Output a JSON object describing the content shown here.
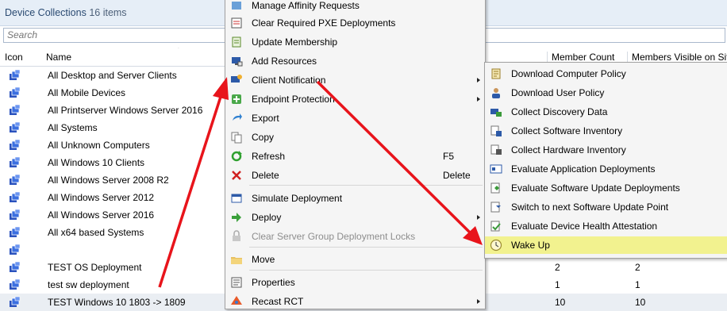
{
  "header": {
    "title": "Device Collections",
    "count": "16 items"
  },
  "search": {
    "placeholder": "Search"
  },
  "columns": {
    "icon": "Icon",
    "name": "Name",
    "member_count": "Member Count",
    "members_visible": "Members Visible on Site"
  },
  "rows": [
    {
      "name": "All Desktop and Server Clients",
      "member_count": "",
      "members_visible": ""
    },
    {
      "name": "All Mobile Devices",
      "member_count": "",
      "members_visible": ""
    },
    {
      "name": "All Printserver Windows Server 2016",
      "member_count": "",
      "members_visible": ""
    },
    {
      "name": "All Systems",
      "member_count": "",
      "members_visible": ""
    },
    {
      "name": "All Unknown Computers",
      "member_count": "",
      "members_visible": ""
    },
    {
      "name": "All Windows 10 Clients",
      "member_count": "",
      "members_visible": ""
    },
    {
      "name": "All Windows Server 2008 R2",
      "member_count": "",
      "members_visible": ""
    },
    {
      "name": "All Windows Server 2012",
      "member_count": "",
      "members_visible": ""
    },
    {
      "name": "All Windows Server 2016",
      "member_count": "",
      "members_visible": ""
    },
    {
      "name": "All x64 based Systems",
      "member_count": "",
      "members_visible": ""
    },
    {
      "name": "",
      "member_count": "",
      "members_visible": ""
    },
    {
      "name": "TEST OS Deployment",
      "member_count": "2",
      "members_visible": "2"
    },
    {
      "name": "test sw deployment",
      "member_count": "1",
      "members_visible": "1"
    },
    {
      "name": "TEST Windows 10 1803 -> 1809",
      "member_count": "10",
      "members_visible": "10"
    }
  ],
  "context_menu": {
    "items": [
      {
        "label": "Manage Affinity Requests",
        "key": "",
        "submenu": false,
        "icon": "affinity-icon"
      },
      {
        "label": "Clear Required PXE Deployments",
        "key": "",
        "submenu": false,
        "icon": "pxe-icon"
      },
      {
        "label": "Update Membership",
        "key": "",
        "submenu": false,
        "icon": "update-membership-icon"
      },
      {
        "label": "Add Resources",
        "key": "",
        "submenu": false,
        "icon": "add-resources-icon"
      },
      {
        "label": "Client Notification",
        "key": "",
        "submenu": true,
        "icon": "client-notification-icon"
      },
      {
        "label": "Endpoint Protection",
        "key": "",
        "submenu": true,
        "icon": "endpoint-protection-icon"
      },
      {
        "label": "Export",
        "key": "",
        "submenu": false,
        "icon": "export-icon"
      },
      {
        "label": "Copy",
        "key": "",
        "submenu": false,
        "icon": "copy-icon"
      },
      {
        "label": "Refresh",
        "key": "F5",
        "submenu": false,
        "icon": "refresh-icon"
      },
      {
        "label": "Delete",
        "key": "Delete",
        "submenu": false,
        "icon": "delete-icon"
      },
      {
        "label": "Simulate Deployment",
        "key": "",
        "submenu": false,
        "icon": "simulate-icon"
      },
      {
        "label": "Deploy",
        "key": "",
        "submenu": true,
        "icon": "deploy-icon"
      },
      {
        "label": "Clear Server Group Deployment Locks",
        "key": "",
        "submenu": false,
        "icon": "locks-icon"
      },
      {
        "label": "Move",
        "key": "",
        "submenu": false,
        "icon": "move-icon"
      },
      {
        "label": "Properties",
        "key": "",
        "submenu": false,
        "icon": "properties-icon"
      },
      {
        "label": "Recast RCT",
        "key": "",
        "submenu": true,
        "icon": "recast-icon"
      }
    ]
  },
  "submenu": {
    "items": [
      {
        "label": "Download Computer Policy",
        "icon": "policy-icon"
      },
      {
        "label": "Download User Policy",
        "icon": "user-policy-icon"
      },
      {
        "label": "Collect Discovery Data",
        "icon": "discovery-icon"
      },
      {
        "label": "Collect Software Inventory",
        "icon": "software-inventory-icon"
      },
      {
        "label": "Collect Hardware Inventory",
        "icon": "hardware-inventory-icon"
      },
      {
        "label": "Evaluate Application Deployments",
        "icon": "app-deploy-icon"
      },
      {
        "label": "Evaluate Software Update Deployments",
        "icon": "sw-update-icon"
      },
      {
        "label": "Switch to next Software Update Point",
        "icon": "switch-sup-icon"
      },
      {
        "label": "Evaluate Device Health Attestation",
        "icon": "health-icon"
      },
      {
        "label": "Wake Up",
        "icon": "clock-icon"
      }
    ]
  },
  "colors": {
    "arrow": "#e8141b",
    "highlight": "#f2f28f",
    "header_bg": "#e6eef7"
  }
}
